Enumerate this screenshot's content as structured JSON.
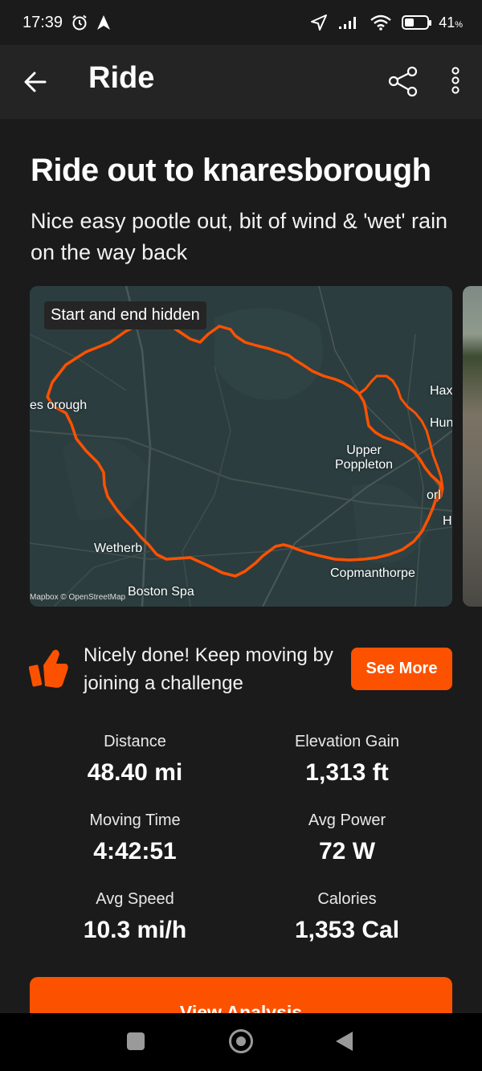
{
  "status_bar": {
    "time": "17:39",
    "battery_percent": "41",
    "battery_percent_symbol": "%",
    "battery_level": 0.41,
    "icons": [
      "alarm-icon",
      "navigation-icon",
      "location-icon",
      "signal-icon",
      "wifi-icon",
      "battery-icon"
    ]
  },
  "app_bar": {
    "title": "Ride",
    "icons": [
      "back-arrow-icon",
      "share-icon",
      "more-vertical-icon"
    ]
  },
  "activity": {
    "title": "Ride out to knaresborough",
    "description": "Nice easy pootle out, bit of wind & 'wet' rain on the way back"
  },
  "map": {
    "badge": "Start and end hidden",
    "attribution": "Mapbox © OpenStreetMap",
    "route_color": "#fc5200",
    "labels": {
      "knaresborough": "es orough",
      "wetherby": "Wetherb",
      "boston_spa": "Boston Spa",
      "upper_poppleton": "Upper\nPoppleton",
      "copmanthorpe": "Copmanthorpe",
      "hax": "Hax",
      "hun": "Hun",
      "york": "orl",
      "h": "H"
    }
  },
  "kudos": {
    "message": "Nicely done! Keep moving by joining a challenge",
    "button_label": "See More",
    "icon": "thumbs-up-icon"
  },
  "stats": [
    {
      "label": "Distance",
      "value": "48.40 mi"
    },
    {
      "label": "Elevation Gain",
      "value": "1,313 ft"
    },
    {
      "label": "Moving Time",
      "value": "4:42:51"
    },
    {
      "label": "Avg Power",
      "value": "72 W"
    },
    {
      "label": "Avg Speed",
      "value": "10.3 mi/h"
    },
    {
      "label": "Calories",
      "value": "1,353 Cal"
    }
  ],
  "actions": {
    "view_analysis": "View Analysis"
  },
  "colors": {
    "accent": "#fc5200",
    "background": "#1b1b1b",
    "app_bar": "#242424"
  }
}
